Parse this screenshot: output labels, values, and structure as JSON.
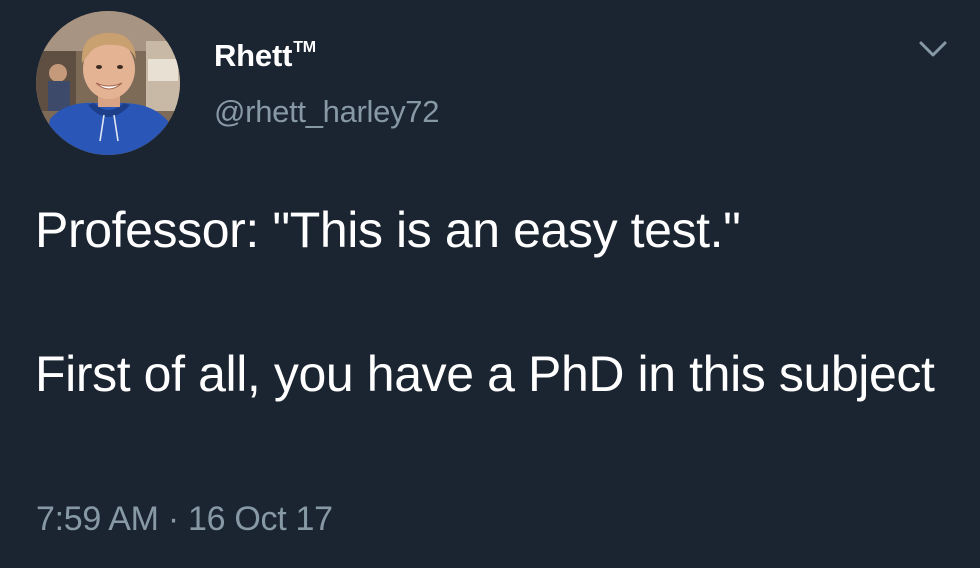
{
  "tweet": {
    "display_name": "Rhett",
    "trademark": "TM",
    "handle": "@rhett_harley72",
    "text_line_1": "Professor: \"This is an easy test.\"",
    "text_line_2": "First of all, you have a PhD in this subject",
    "time": "7:59 AM",
    "separator": "·",
    "date": "16 Oct 17"
  },
  "icons": {
    "avatar": "avatar-photo",
    "menu": "chevron-down-icon"
  },
  "colors": {
    "background": "#1b2431",
    "primary_text": "#ffffff",
    "secondary_text": "#8899a6"
  }
}
